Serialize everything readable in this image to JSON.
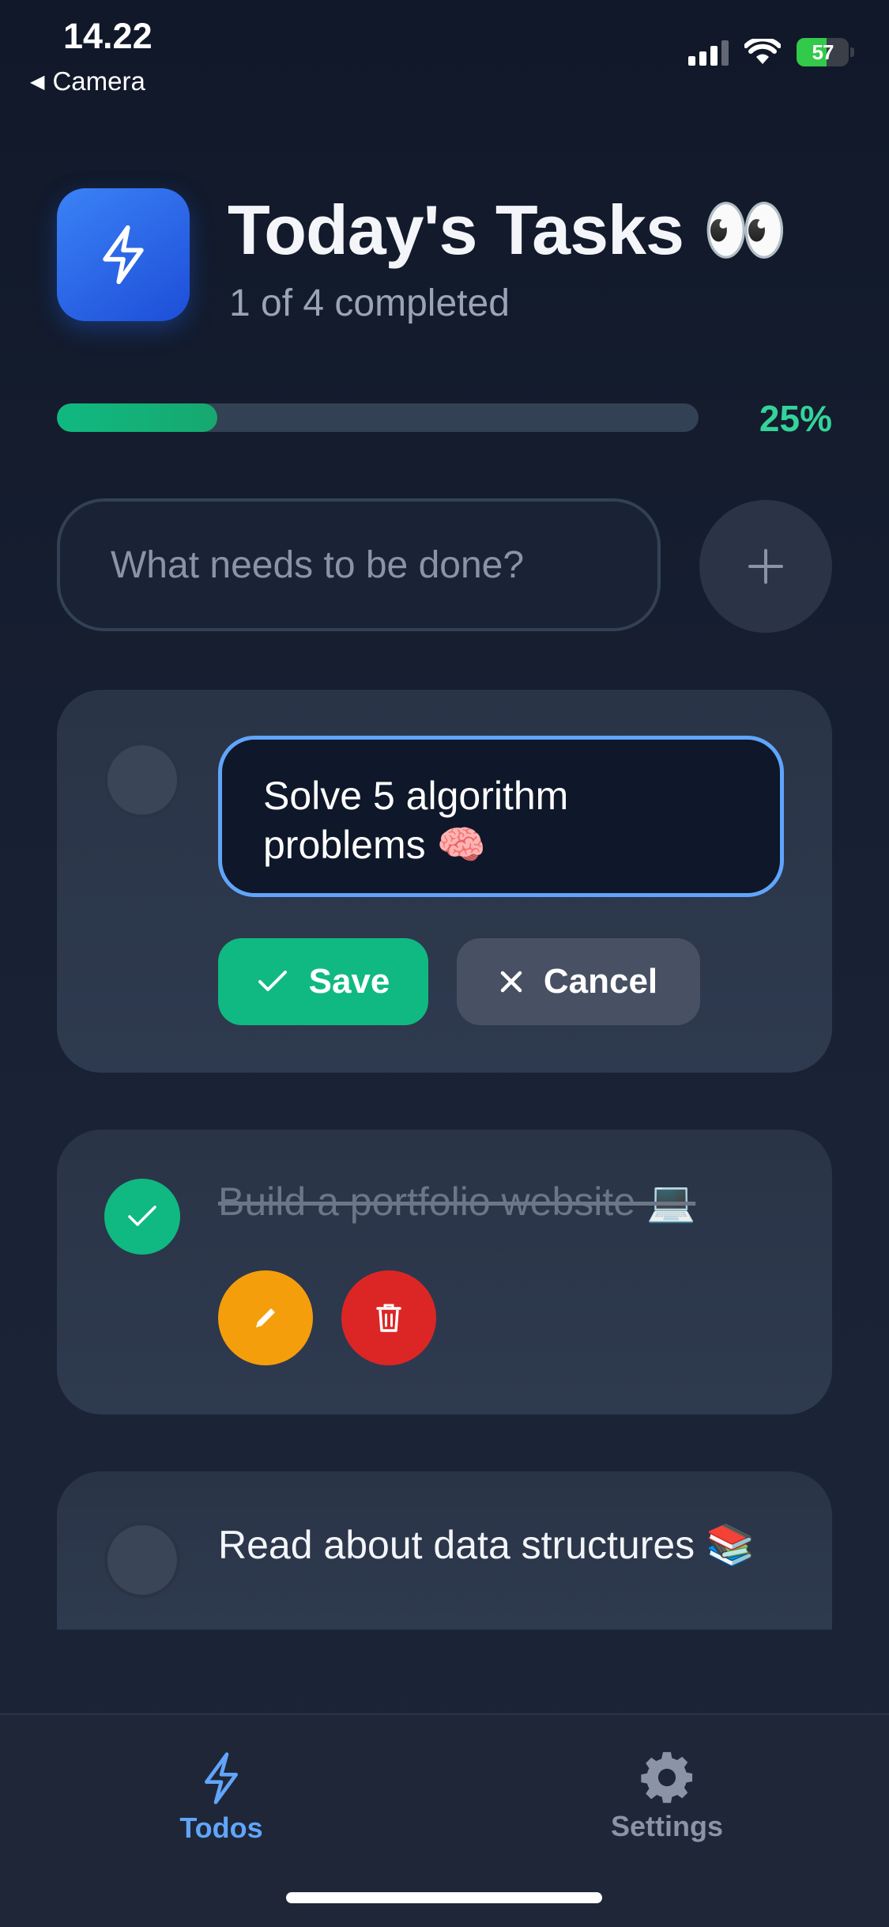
{
  "status_bar": {
    "time": "14.22",
    "back_app": "Camera",
    "battery_percent": "57",
    "battery_level": 0.57,
    "battery_color": "#33c94a"
  },
  "header": {
    "app_icon": "lightning-icon",
    "title": "Today's Tasks 👀",
    "subtitle": "1 of 4 completed"
  },
  "progress": {
    "percent_label": "25%",
    "fraction": 0.25,
    "color": "#10b981"
  },
  "add_task": {
    "placeholder": "What needs to be done?",
    "button_icon": "plus-icon"
  },
  "tasks": [
    {
      "text": "Solve 5 algorithm problems 🧠",
      "completed": false,
      "editing": true,
      "save_label": "Save",
      "cancel_label": "Cancel"
    },
    {
      "text": "Build a portfolio website 💻",
      "completed": true,
      "editing": false,
      "edit_icon": "pencil-icon",
      "delete_icon": "trash-icon"
    },
    {
      "text": "Read about data structures 📚",
      "completed": false,
      "editing": false
    }
  ],
  "tab_bar": {
    "tabs": [
      {
        "label": "Todos",
        "icon": "lightning-icon",
        "active": true
      },
      {
        "label": "Settings",
        "icon": "gear-icon",
        "active": false
      }
    ]
  },
  "colors": {
    "accent_blue": "#60a5fa",
    "accent_green": "#10b981",
    "edit_orange": "#f59e0b",
    "delete_red": "#dc2626",
    "background": "#131b2e"
  }
}
